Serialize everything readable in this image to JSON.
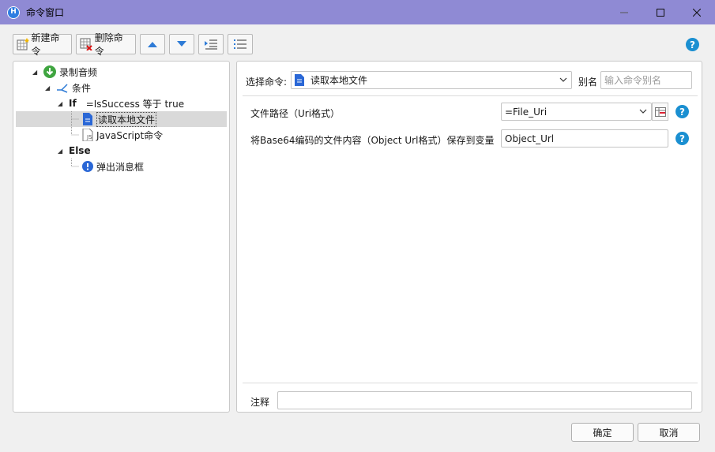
{
  "window": {
    "title": "命令窗口"
  },
  "toolbar": {
    "new_label": "新建命令",
    "delete_label": "删除命令"
  },
  "tree": {
    "root": "录制音频",
    "condition": "条件",
    "if_keyword": "If",
    "if_expression": "=IsSuccess 等于 true",
    "read_file": "读取本地文件",
    "javascript": "JavaScript命令",
    "else_keyword": "Else",
    "message_box": "弹出消息框"
  },
  "command": {
    "select_label": "选择命令:",
    "selected": "读取本地文件",
    "alias_label": "别名",
    "alias_placeholder": "输入命令别名"
  },
  "params": {
    "file_path_label": "文件路径（Uri格式）",
    "file_path_value": "=File_Uri",
    "save_label": "将Base64编码的文件内容（Object Url格式）保存到变量",
    "save_value": "Object_Url"
  },
  "comment": {
    "label": "注释"
  },
  "buttons": {
    "ok": "确定",
    "cancel": "取消"
  },
  "colors": {
    "titlebar": "#8f8ad4",
    "help": "#1a8fd1",
    "tree_root": "#3fa540",
    "doc_icon": "#2a67d6"
  }
}
